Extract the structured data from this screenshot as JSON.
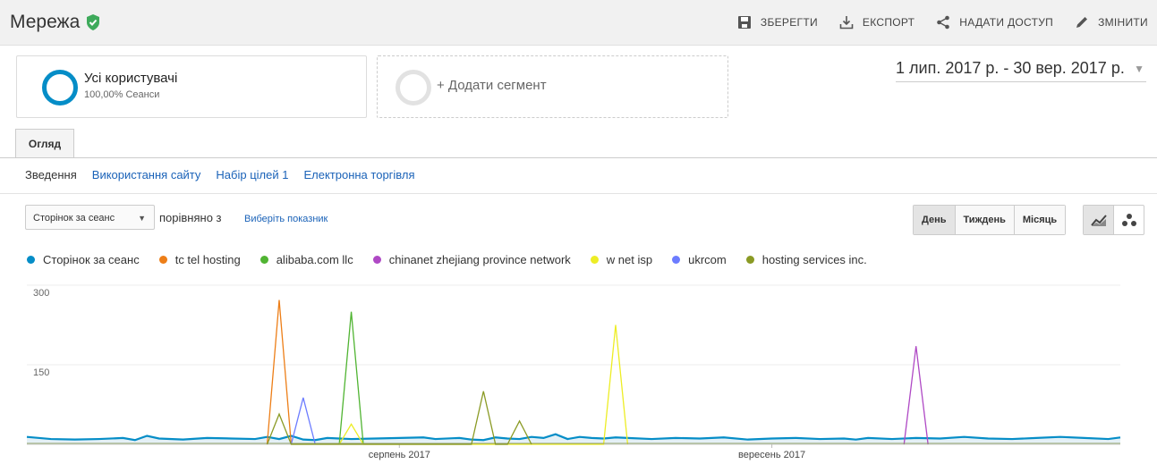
{
  "header": {
    "title": "Мережа",
    "actions": {
      "save": "ЗБЕРЕГТИ",
      "export": "ЕКСПОРТ",
      "share": "НАДАТИ ДОСТУП",
      "edit": "ЗМІНИТИ"
    }
  },
  "segments": {
    "primary": {
      "name": "Усі користувачі",
      "sub": "100,00% Сеанси"
    },
    "add": "+ Додати сегмент"
  },
  "date_range": "1 лип. 2017 р. - 30 вер. 2017 р.",
  "tabs": {
    "overview": "Огляд"
  },
  "subnav": [
    "Зведення",
    "Використання сайту",
    "Набір цілей 1",
    "Електронна торгівля"
  ],
  "controls": {
    "metric": "Сторінок за сеанс",
    "compare": "порівняно з",
    "pick": "Виберіть показник",
    "periods": [
      "День",
      "Тиждень",
      "Місяць"
    ]
  },
  "colors": {
    "accent": "#058dc7",
    "link": "#1a62b8",
    "shield": "#3eaa5b"
  },
  "chart_data": {
    "type": "line",
    "x_labels": [
      {
        "day": 31,
        "label": "серпень 2017"
      },
      {
        "day": 62,
        "label": "вересень 2017"
      }
    ],
    "ylim": [
      0,
      300
    ],
    "yticks": [
      150,
      300
    ],
    "grid": true,
    "legend_position": "top",
    "days": 92,
    "series": [
      {
        "name": "Сторінок за сеанс",
        "color": "#058dc7",
        "fill": true,
        "base": 9,
        "points": [
          [
            0,
            14
          ],
          [
            2,
            10
          ],
          [
            4,
            9
          ],
          [
            6,
            10
          ],
          [
            8,
            12
          ],
          [
            9,
            8
          ],
          [
            10,
            16
          ],
          [
            11,
            11
          ],
          [
            13,
            9
          ],
          [
            15,
            12
          ],
          [
            17,
            11
          ],
          [
            19,
            10
          ],
          [
            20,
            14
          ],
          [
            21,
            10
          ],
          [
            22,
            16
          ],
          [
            23,
            9
          ],
          [
            24,
            8
          ],
          [
            25,
            12
          ],
          [
            27,
            10
          ],
          [
            29,
            11
          ],
          [
            31,
            12
          ],
          [
            33,
            13
          ],
          [
            34,
            10
          ],
          [
            36,
            12
          ],
          [
            37,
            9
          ],
          [
            38,
            8
          ],
          [
            39,
            13
          ],
          [
            40,
            11
          ],
          [
            41,
            10
          ],
          [
            42,
            14
          ],
          [
            43,
            12
          ],
          [
            44,
            19
          ],
          [
            45,
            10
          ],
          [
            46,
            14
          ],
          [
            47,
            12
          ],
          [
            48,
            11
          ],
          [
            49,
            13
          ],
          [
            50,
            12
          ],
          [
            52,
            10
          ],
          [
            54,
            12
          ],
          [
            56,
            11
          ],
          [
            58,
            13
          ],
          [
            60,
            9
          ],
          [
            62,
            11
          ],
          [
            64,
            12
          ],
          [
            66,
            10
          ],
          [
            68,
            11
          ],
          [
            69,
            9
          ],
          [
            70,
            12
          ],
          [
            72,
            10
          ],
          [
            74,
            12
          ],
          [
            76,
            11
          ],
          [
            78,
            14
          ],
          [
            80,
            11
          ],
          [
            82,
            10
          ],
          [
            84,
            12
          ],
          [
            86,
            14
          ],
          [
            88,
            12
          ],
          [
            90,
            10
          ],
          [
            91,
            13
          ]
        ]
      },
      {
        "name": "tc tel hosting",
        "color": "#ed7e17",
        "points": [
          [
            20,
            0
          ],
          [
            21,
            272
          ],
          [
            22,
            0
          ]
        ]
      },
      {
        "name": "alibaba.com llc",
        "color": "#50b432",
        "points": [
          [
            26,
            0
          ],
          [
            27,
            250
          ],
          [
            28,
            0
          ]
        ]
      },
      {
        "name": "chinanet zhejiang province network",
        "color": "#af49c5",
        "points": [
          [
            73,
            0
          ],
          [
            74,
            185
          ],
          [
            75,
            0
          ]
        ]
      },
      {
        "name": "w net isp",
        "color": "#eded25",
        "points": [
          [
            26,
            0
          ],
          [
            27,
            38
          ],
          [
            28,
            0
          ],
          [
            48,
            0
          ],
          [
            49,
            225
          ],
          [
            50,
            0
          ]
        ]
      },
      {
        "name": "ukrcom",
        "color": "#6c7cff",
        "points": [
          [
            22,
            0
          ],
          [
            23,
            88
          ],
          [
            24,
            0
          ]
        ]
      },
      {
        "name": "hosting services inc.",
        "color": "#8a9a24",
        "points": [
          [
            20,
            0
          ],
          [
            21,
            57
          ],
          [
            22,
            0
          ],
          [
            37,
            0
          ],
          [
            38,
            100
          ],
          [
            39,
            0
          ],
          [
            40,
            0
          ],
          [
            41,
            44
          ],
          [
            42,
            0
          ]
        ]
      }
    ]
  }
}
